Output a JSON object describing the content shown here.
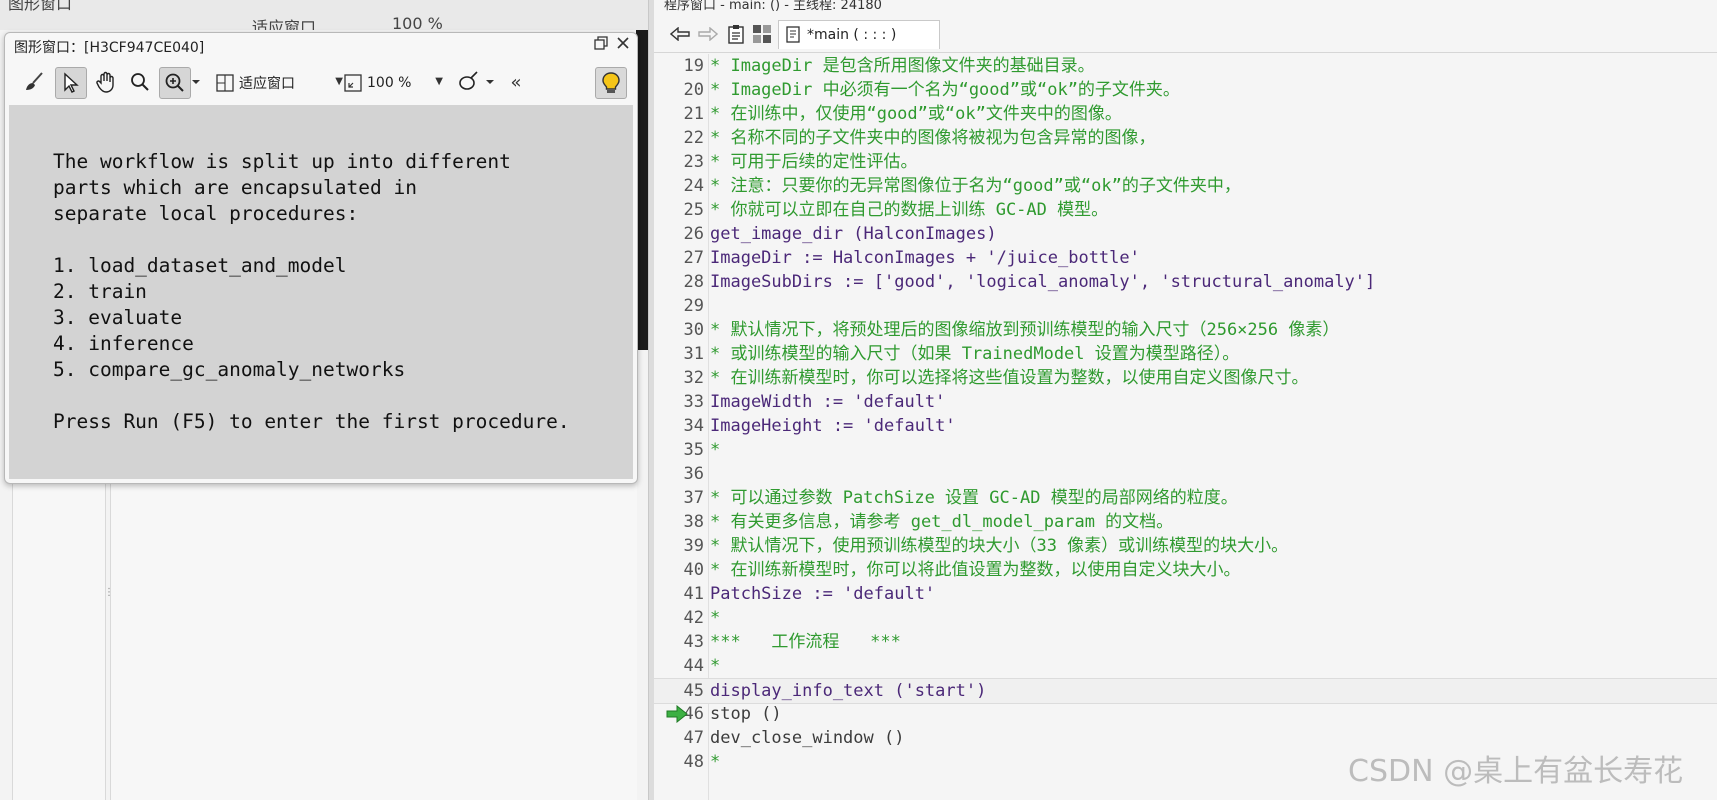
{
  "left_strip": {
    "ghost_title": "图形窗口",
    "ghost_zoom": "适应窗口",
    "ghost_zoom_pct": "100 %"
  },
  "graphics_window": {
    "title": "图形窗口：[H3CF947CE040]",
    "toolbar": {
      "fit_label": "适应窗口",
      "zoom_label": "100 %",
      "collapse_label": "«"
    },
    "info_lines": [
      "The workflow is split up into different",
      "parts which are encapsulated in",
      "separate local procedures:",
      "",
      "1. load_dataset_and_model",
      "2. train",
      "3. evaluate",
      "4. inference",
      "5. compare_gc_anomaly_networks",
      "",
      "Press Run (F5) to enter the first procedure."
    ]
  },
  "editor": {
    "topbar_text": "程序窗口 - main: () - 主线程: 24180",
    "tab_label": "*main ( : : : )",
    "current_line": 45,
    "pc_line": 46,
    "lines": [
      {
        "no": "19",
        "text": "* ImageDir 是包含所用图像文件夹的基础目录。",
        "kind": "comment"
      },
      {
        "no": "20",
        "text": "* ImageDir 中必须有一个名为“good”或“ok”的子文件夹。",
        "kind": "comment"
      },
      {
        "no": "21",
        "text": "* 在训练中，仅使用“good”或“ok”文件夹中的图像。",
        "kind": "comment"
      },
      {
        "no": "22",
        "text": "* 名称不同的子文件夹中的图像将被视为包含异常的图像，",
        "kind": "comment"
      },
      {
        "no": "23",
        "text": "* 可用于后续的定性评估。",
        "kind": "comment"
      },
      {
        "no": "24",
        "text": "* 注意：只要你的无异常图像位于名为“good”或“ok”的子文件夹中，",
        "kind": "comment"
      },
      {
        "no": "25",
        "text": "* 你就可以立即在自己的数据上训练 GC-AD 模型。",
        "kind": "comment"
      },
      {
        "no": "26",
        "text": "get_image_dir (HalconImages)",
        "kind": "op"
      },
      {
        "no": "27",
        "text": "ImageDir := HalconImages + '/juice_bottle'",
        "kind": "op"
      },
      {
        "no": "28",
        "text": "ImageSubDirs := ['good', 'logical_anomaly', 'structural_anomaly']",
        "kind": "op"
      },
      {
        "no": "29",
        "text": "",
        "kind": "code"
      },
      {
        "no": "30",
        "text": "* 默认情况下，将预处理后的图像缩放到预训练模型的输入尺寸（256×256 像素）",
        "kind": "comment"
      },
      {
        "no": "31",
        "text": "* 或训练模型的输入尺寸（如果 TrainedModel 设置为模型路径）。",
        "kind": "comment"
      },
      {
        "no": "32",
        "text": "* 在训练新模型时，你可以选择将这些值设置为整数，以使用自定义图像尺寸。",
        "kind": "comment"
      },
      {
        "no": "33",
        "text": "ImageWidth := 'default'",
        "kind": "op"
      },
      {
        "no": "34",
        "text": "ImageHeight := 'default'",
        "kind": "op"
      },
      {
        "no": "35",
        "text": "*",
        "kind": "comment"
      },
      {
        "no": "36",
        "text": "",
        "kind": "code"
      },
      {
        "no": "37",
        "text": "* 可以通过参数 PatchSize 设置 GC-AD 模型的局部网络的粒度。",
        "kind": "comment"
      },
      {
        "no": "38",
        "text": "* 有关更多信息，请参考 get_dl_model_param 的文档。",
        "kind": "comment"
      },
      {
        "no": "39",
        "text": "* 默认情况下，使用预训练模型的块大小（33 像素）或训练模型的块大小。",
        "kind": "comment"
      },
      {
        "no": "40",
        "text": "* 在训练新模型时，你可以将此值设置为整数，以使用自定义块大小。",
        "kind": "comment"
      },
      {
        "no": "41",
        "text": "PatchSize := 'default'",
        "kind": "op"
      },
      {
        "no": "42",
        "text": "*",
        "kind": "comment"
      },
      {
        "no": "43",
        "text": "***   工作流程   ***",
        "kind": "comment"
      },
      {
        "no": "44",
        "text": "*",
        "kind": "comment"
      },
      {
        "no": "45",
        "text": "display_info_text ('start')",
        "kind": "op"
      },
      {
        "no": "46",
        "text": "stop ()",
        "kind": "code"
      },
      {
        "no": "47",
        "text": "dev_close_window ()",
        "kind": "code"
      },
      {
        "no": "48",
        "text": "*",
        "kind": "comment"
      }
    ]
  },
  "watermark": "CSDN @桌上有盆长寿花",
  "colors": {
    "comment": "#2f9a2f",
    "operator": "#4b2878",
    "code": "#3c3c3c",
    "graphics_bg": "#d3d3d3"
  }
}
